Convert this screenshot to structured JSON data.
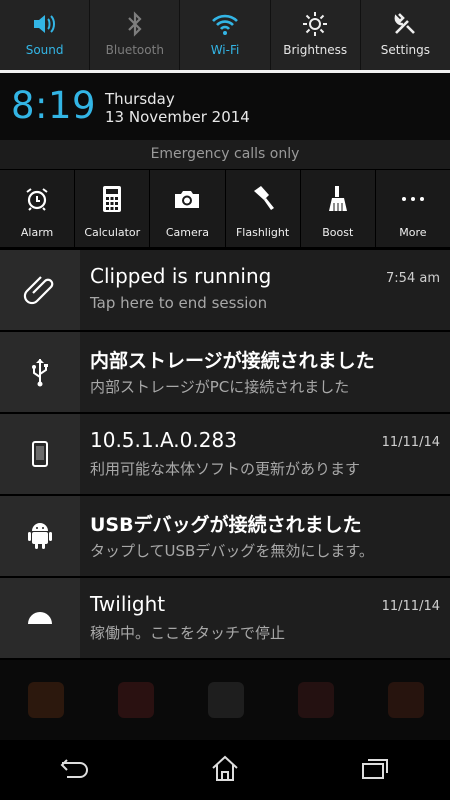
{
  "quick_settings": [
    {
      "label": "Sound",
      "icon": "speaker-icon",
      "state": "on"
    },
    {
      "label": "Bluetooth",
      "icon": "bluetooth-icon",
      "state": "off"
    },
    {
      "label": "Wi-Fi",
      "icon": "wifi-icon",
      "state": "on"
    },
    {
      "label": "Brightness",
      "icon": "brightness-icon",
      "state": "neutral"
    },
    {
      "label": "Settings",
      "icon": "wrench-icon",
      "state": "neutral"
    }
  ],
  "header": {
    "time": "8:19",
    "day": "Thursday",
    "date": "13 November 2014"
  },
  "emergency_text": "Emergency calls only",
  "tools": [
    {
      "label": "Alarm",
      "icon": "alarm-clock-icon"
    },
    {
      "label": "Calculator",
      "icon": "calculator-icon"
    },
    {
      "label": "Camera",
      "icon": "camera-icon"
    },
    {
      "label": "Flashlight",
      "icon": "flashlight-icon"
    },
    {
      "label": "Boost",
      "icon": "broom-icon"
    },
    {
      "label": "More",
      "icon": "more-dots-icon"
    }
  ],
  "notifications": [
    {
      "title": "Clipped is running",
      "subtitle": "Tap here to end session",
      "time": "7:54 am",
      "icon": "paperclip-icon"
    },
    {
      "title": "内部ストレージが接続されました",
      "subtitle": "内部ストレージがPCに接続されました",
      "time": "",
      "icon": "usb-icon"
    },
    {
      "title": "10.5.1.A.0.283",
      "subtitle": "利用可能な本体ソフトの更新があります",
      "time": "11/11/14",
      "icon": "phone-icon"
    },
    {
      "title": "USBデバッグが接続されました",
      "subtitle": "タップしてUSBデバッグを無効にします。",
      "time": "",
      "icon": "android-icon"
    },
    {
      "title": "Twilight",
      "subtitle": "稼働中。ここをタッチで停止",
      "time": "11/11/14",
      "icon": "half-circle-icon"
    }
  ],
  "colors": {
    "accent": "#33b5e5",
    "disabled": "#7d7d7d"
  }
}
